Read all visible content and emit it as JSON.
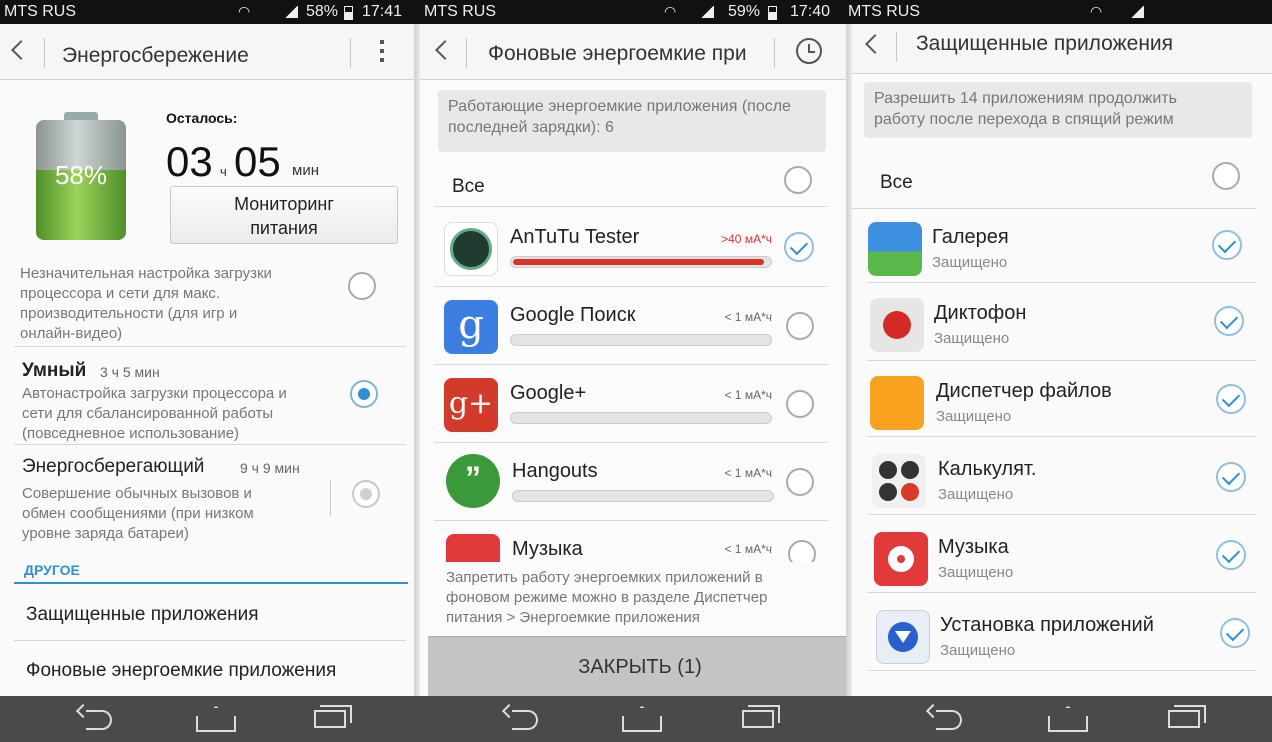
{
  "status": {
    "left": {
      "carrier": "MTS RUS",
      "battery": "58%",
      "time": "17:41"
    },
    "mid": {
      "carrier": "MTS RUS",
      "battery": "59%",
      "time": "17:40"
    },
    "right": {
      "carrier": "MTS RUS"
    }
  },
  "panel1": {
    "title": "Энергосбережение",
    "battery_percent": "58%",
    "battery_level": 0.58,
    "remaining_label": "Осталось:",
    "time_hours": "03",
    "time_h_unit": "ч",
    "time_minutes": "05",
    "time_min_unit": "мин",
    "monitor_button": [
      "Мониторинг",
      "питания"
    ],
    "mode_performance_desc": [
      "Незначительная настройка загрузки",
      "процессора и сети для макс.",
      "производительности (для игр и",
      "онлайн-видео)"
    ],
    "mode_smart_title": "Умный",
    "mode_smart_time": "3 ч 5 мин",
    "mode_smart_desc": [
      "Автонастройка загрузки процессора и",
      "сети для сбалансированной работы",
      "(повседневное использование)"
    ],
    "mode_saver_title": "Энергосберегающий",
    "mode_saver_time": "9 ч 9 мин",
    "mode_saver_desc": [
      "Совершение обычных вызовов и",
      "обмен сообщениями (при низком",
      "уровне заряда батареи)"
    ],
    "section_other": "ДРУГОЕ",
    "link_protected": "Защищенные приложения",
    "link_background": "Фоновые энергоемкие приложения"
  },
  "panel2": {
    "title": "Фоновые энергоемкие при",
    "info": [
      "Работающие энергоемкие приложения (после",
      "последней зарядки): 6"
    ],
    "all_label": "Все",
    "apps": [
      {
        "name": "AnTuTu Tester",
        "usage": ">40 мА*ч",
        "level": 0.98,
        "checked": true
      },
      {
        "name": "Google Поиск",
        "usage": "< 1 мА*ч",
        "level": 0,
        "checked": false
      },
      {
        "name": "Google+",
        "usage": "< 1 мА*ч",
        "level": 0,
        "checked": false
      },
      {
        "name": "Hangouts",
        "usage": "< 1 мА*ч",
        "level": 0,
        "checked": false
      },
      {
        "name": "Музыка",
        "usage": "< 1 мА*ч",
        "level": 0,
        "checked": false
      }
    ],
    "footer": [
      "Запретить работу энергоемких приложений в",
      "фоновом режиме можно в разделе Диспетчер",
      "питания > Энергоемкие приложения"
    ],
    "close_button": "ЗАКРЫТЬ (1)"
  },
  "panel3": {
    "title": "Защищенные приложения",
    "info": [
      "Разрешить 14 приложениям продолжить",
      "работу после перехода в спящий режим"
    ],
    "all_label": "Все",
    "apps": [
      {
        "name": "Галерея",
        "status": "Защищено"
      },
      {
        "name": "Диктофон",
        "status": "Защищено"
      },
      {
        "name": "Диспетчер файлов",
        "status": "Защищено"
      },
      {
        "name": "Калькулят.",
        "status": "Защищено"
      },
      {
        "name": "Музыка",
        "status": "Защищено"
      },
      {
        "name": "Установка приложений",
        "status": "Защищено"
      }
    ]
  },
  "colors": {
    "accent": "#2c8fd8",
    "battery_green": "#6fb53a",
    "usage_red": "#d9342b",
    "navbar": "#4a4a4a"
  }
}
